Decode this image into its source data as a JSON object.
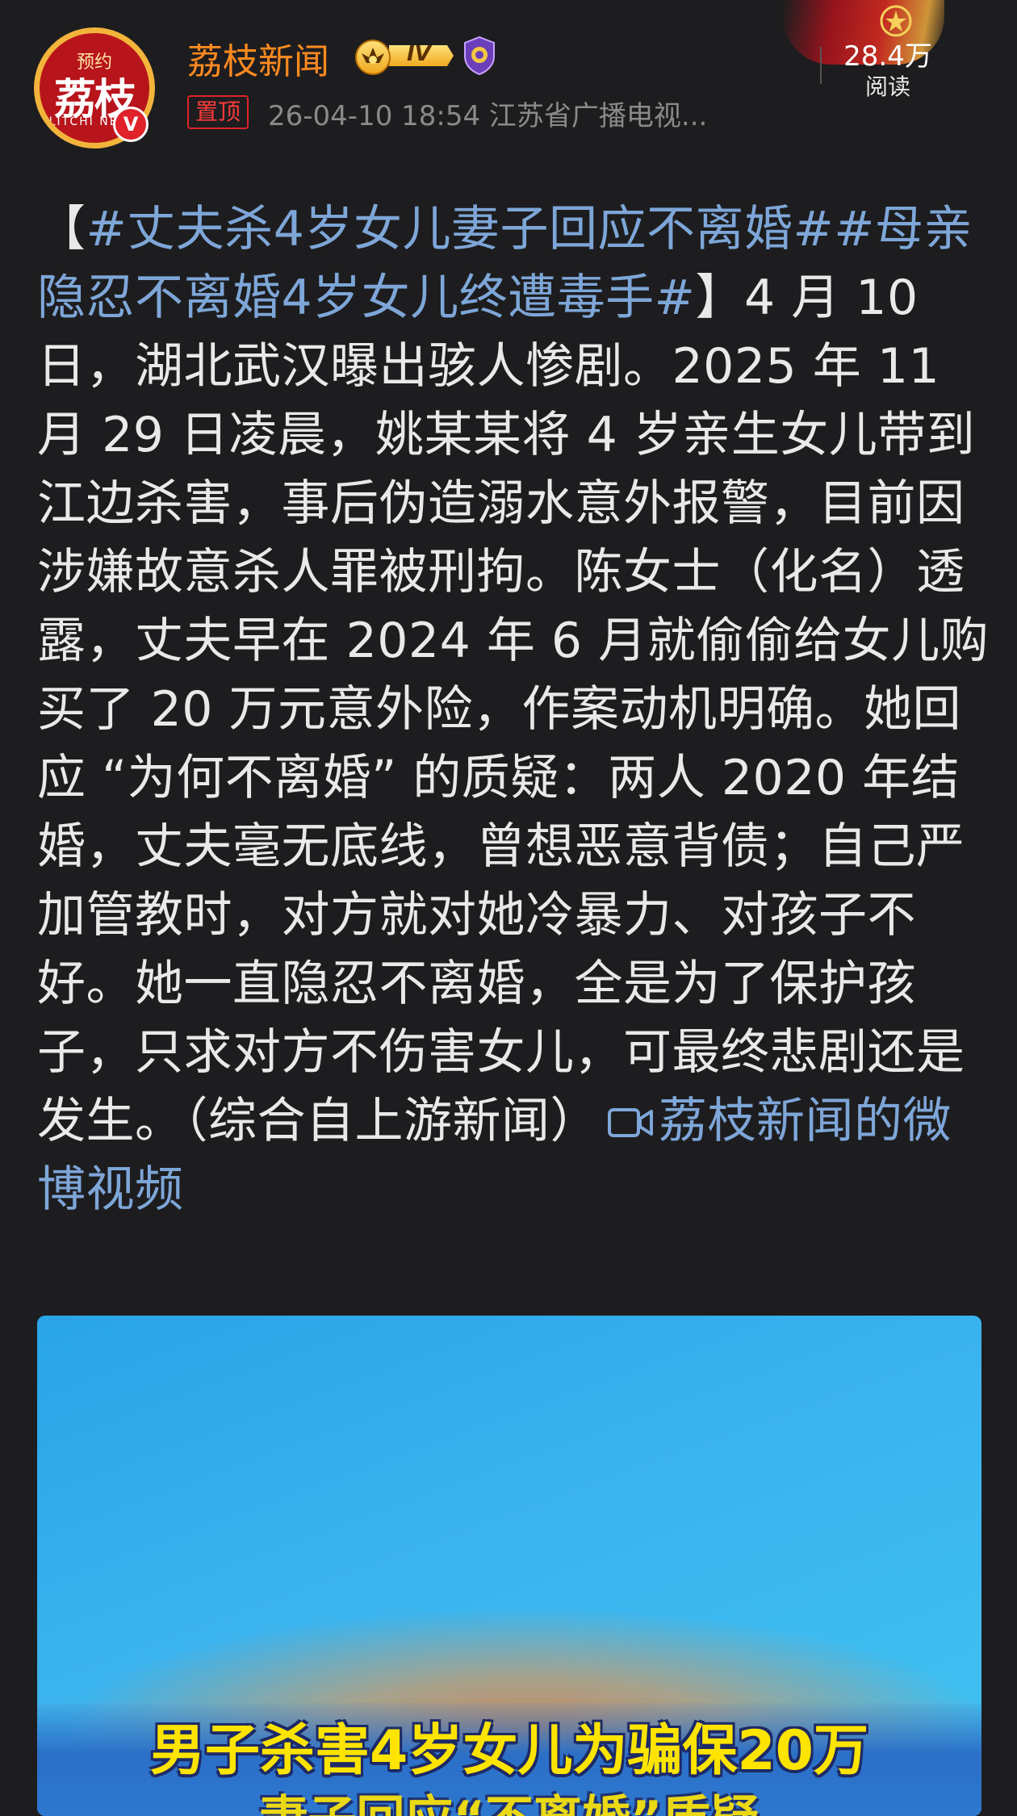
{
  "author": {
    "avatar_top": "预约",
    "avatar_main": "荔枝",
    "avatar_sub": "LITCHI NEWS",
    "verified_mark": "V",
    "name": "荔枝新闻",
    "level": "IV"
  },
  "post": {
    "pin_label": "置顶",
    "meta": "26-04-10 18:54  江苏省广播电视...",
    "read_count": "28.4万",
    "read_label": "阅读"
  },
  "content": {
    "open_bracket": "【",
    "topic_1": "#丈夫杀4岁女儿妻子回应不离婚#",
    "topic_2": "#母亲隐忍不离婚4岁女儿终遭毒手#",
    "close_bracket": "】",
    "body": "4 月 10 日，湖北武汉曝出骇人惨剧。2025 年 11 月 29 日凌晨，姚某某将 4 岁亲生女儿带到江边杀害，事后伪造溺水意外报警，目前因涉嫌故意杀人罪被刑拘。陈女士（化名）透露，丈夫早在 2024 年 6 月就偷偷给女儿购买了 20 万元意外险，作案动机明确。她回应 “为何不离婚” 的质疑：两人 2020 年结婚，丈夫毫无底线，曾想恶意背债；自己严加管教时，对方就对她冷暴力、对孩子不好。她一直隐忍不离婚，全是为了保护孩子，只求对方不伤害女儿，可最终悲剧还是发生。（综合自上游新闻）",
    "video_link_head": "荔枝新闻的",
    "video_link_tail": "微博视频"
  },
  "video": {
    "caption_line1": "男子杀害4岁女儿为骗保20万",
    "caption_line2": "妻子回应“不离婚”质疑"
  },
  "icons": {
    "video_link": "video-camera-icon",
    "crown": "crown-badge-icon",
    "shield": "shield-badge-icon"
  },
  "colors": {
    "background": "#1d1d1f",
    "username": "#ff8a1f",
    "link": "#7ea6d8",
    "pin": "#e0222b",
    "caption": "#ffe400"
  }
}
